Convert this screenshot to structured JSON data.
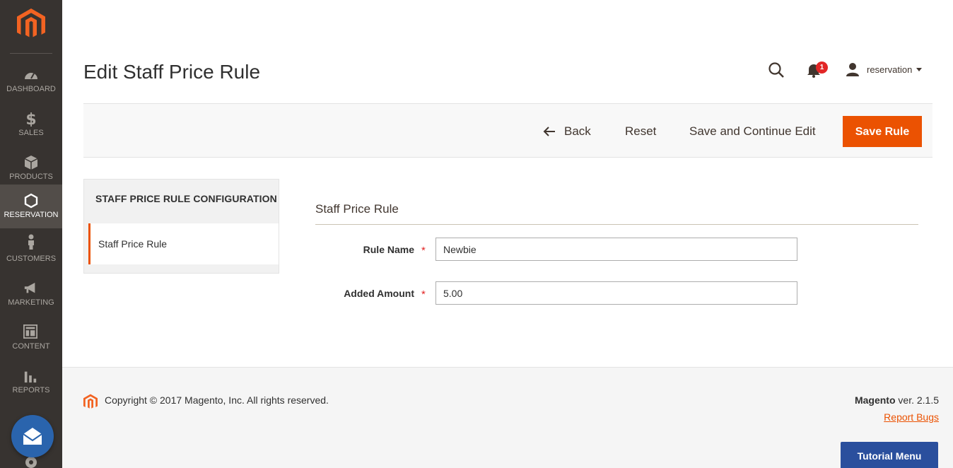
{
  "sidebar": {
    "items": [
      {
        "label": "DASHBOARD",
        "icon": "dashboard-icon"
      },
      {
        "label": "SALES",
        "icon": "dollar-icon"
      },
      {
        "label": "PRODUCTS",
        "icon": "box-icon"
      },
      {
        "label": "RESERVATION",
        "icon": "hexagon-icon",
        "active": true
      },
      {
        "label": "CUSTOMERS",
        "icon": "person-icon"
      },
      {
        "label": "MARKETING",
        "icon": "megaphone-icon"
      },
      {
        "label": "CONTENT",
        "icon": "layout-icon"
      },
      {
        "label": "REPORTS",
        "icon": "bar-chart-icon"
      }
    ]
  },
  "header": {
    "title": "Edit Staff Price Rule",
    "notification_count": "1",
    "username": "reservation"
  },
  "actions": {
    "back": "Back",
    "reset": "Reset",
    "save_continue": "Save and Continue Edit",
    "save": "Save Rule"
  },
  "tabs": {
    "title": "STAFF PRICE RULE CONFIGURATION",
    "items": [
      {
        "label": "Staff Price Rule"
      }
    ]
  },
  "form": {
    "fieldset_title": "Staff Price Rule",
    "fields": [
      {
        "label": "Rule Name",
        "value": "Newbie",
        "required_mark": "*"
      },
      {
        "label": "Added Amount",
        "value": "5.00",
        "required_mark": "*"
      }
    ]
  },
  "footer": {
    "copyright": "Copyright © 2017 Magento, Inc. All rights reserved.",
    "brand": "Magento",
    "version": " ver. 2.1.5",
    "report_bugs": "Report Bugs",
    "tutorial_menu": "Tutorial Menu"
  },
  "colors": {
    "sidebar_bg": "#373330",
    "accent": "#eb5202",
    "tutorial_bg": "#2a4f9d"
  }
}
